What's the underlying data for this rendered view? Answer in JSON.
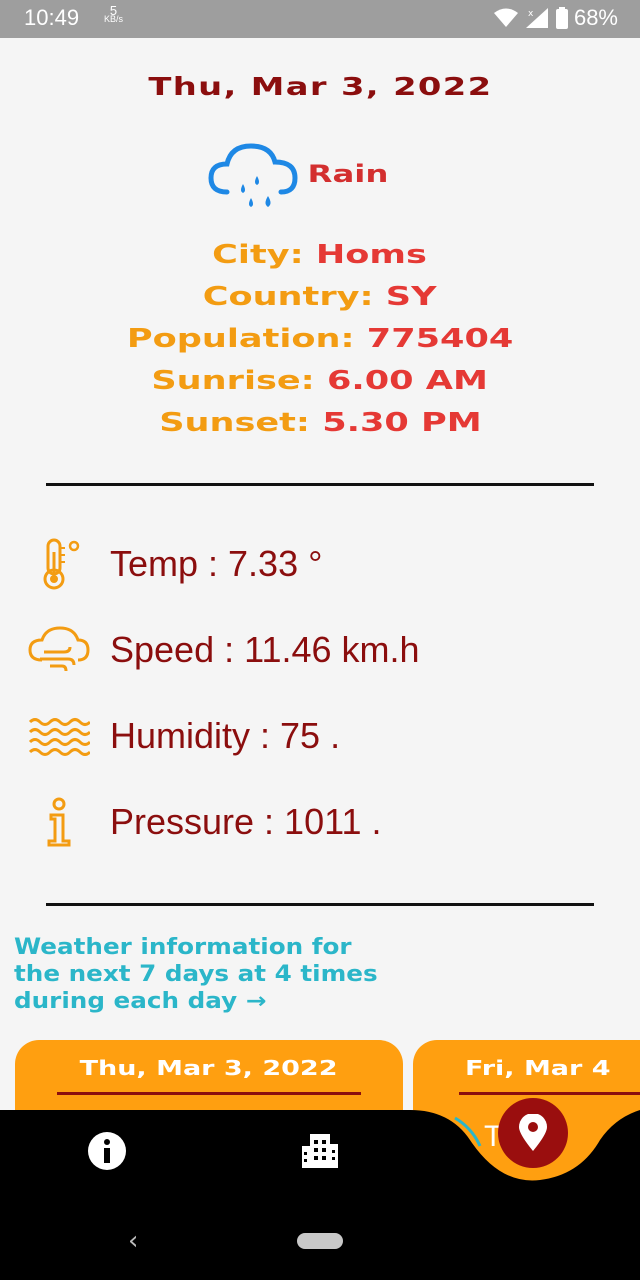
{
  "status_bar": {
    "time": "10:49",
    "net_speed_value": "5",
    "net_speed_unit": "KB/s",
    "battery": "68%"
  },
  "header": {
    "date": "Thu, Mar 3, 2022",
    "condition": "Rain",
    "condition_icon": "cloud-rain-icon"
  },
  "location": {
    "city_label": "City:",
    "city": "Homs",
    "country_label": "Country:",
    "country": "SY",
    "population_label": "Population:",
    "population": "775404",
    "sunrise_label": "Sunrise:",
    "sunrise": "6.00 AM",
    "sunset_label": "Sunset:",
    "sunset": "5.30 PM"
  },
  "metrics": [
    {
      "icon": "thermometer-icon",
      "text": "Temp :   7.33 °"
    },
    {
      "icon": "wind-icon",
      "text": "Speed : 11.46 km.h"
    },
    {
      "icon": "humidity-waves-icon",
      "text": "Humidity :  75 ."
    },
    {
      "icon": "info-icon",
      "text": "Pressure :  1011 ."
    }
  ],
  "forecast": {
    "link_line1": "Weather information  for",
    "link_line2": "the next 7 days at 4 times",
    "link_line3": "during each day →",
    "cards": [
      {
        "date": "Thu, Mar 3, 2022"
      },
      {
        "date": "Fri, Mar 4"
      }
    ],
    "partial_text": "T    :"
  },
  "colors": {
    "dark_red": "#8b0e0e",
    "orange": "#f39c12",
    "red": "#e53935",
    "teal": "#2bb6c9",
    "card": "#ff9f10"
  },
  "bottom_nav": {
    "items": [
      "info-icon",
      "city-icon",
      "location-pin-icon"
    ]
  }
}
